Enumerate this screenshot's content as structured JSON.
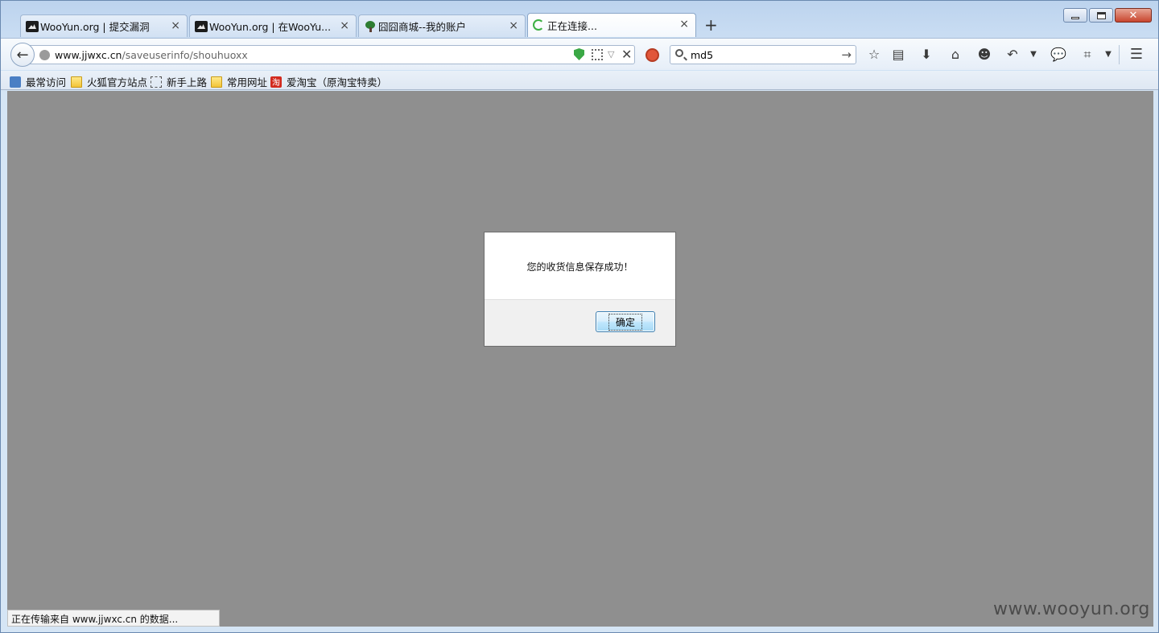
{
  "tabs": [
    {
      "title": "WooYun.org | 提交漏洞",
      "favicon": "wooyun-icon",
      "close": "×"
    },
    {
      "title": "WooYun.org | 在WooYu...",
      "favicon": "wooyun-icon",
      "close": "×"
    },
    {
      "title": "囧囧商城--我的账户",
      "favicon": "tree-icon",
      "close": "×"
    },
    {
      "title": "正在连接...",
      "favicon": "loading-spinner-icon",
      "close": "×",
      "active": true
    }
  ],
  "new_tab": "+",
  "navbar": {
    "url_host": "www.jjwxc.cn",
    "url_path": "/saveuserinfo/shouhuoxx",
    "search_value": "md5"
  },
  "bookmarks": [
    {
      "label": "最常访问",
      "icon": "most-visited-icon"
    },
    {
      "label": "火狐官方站点",
      "icon": "folder-icon"
    },
    {
      "label": "新手上路",
      "icon": "dotted-page-icon"
    },
    {
      "label": "常用网址",
      "icon": "folder-icon"
    },
    {
      "label": "爱淘宝（原淘宝特卖）",
      "icon": "taobao-icon"
    }
  ],
  "dialog": {
    "message": "您的收货信息保存成功！",
    "ok_label": "确定"
  },
  "status": "正在传输来自 www.jjwxc.cn 的数据...",
  "watermark": "www.wooyun.org",
  "colors": {
    "overlay": "#8f8f8f",
    "chrome": "#c8dcf2",
    "ok_button_border": "#3c7fb1"
  }
}
